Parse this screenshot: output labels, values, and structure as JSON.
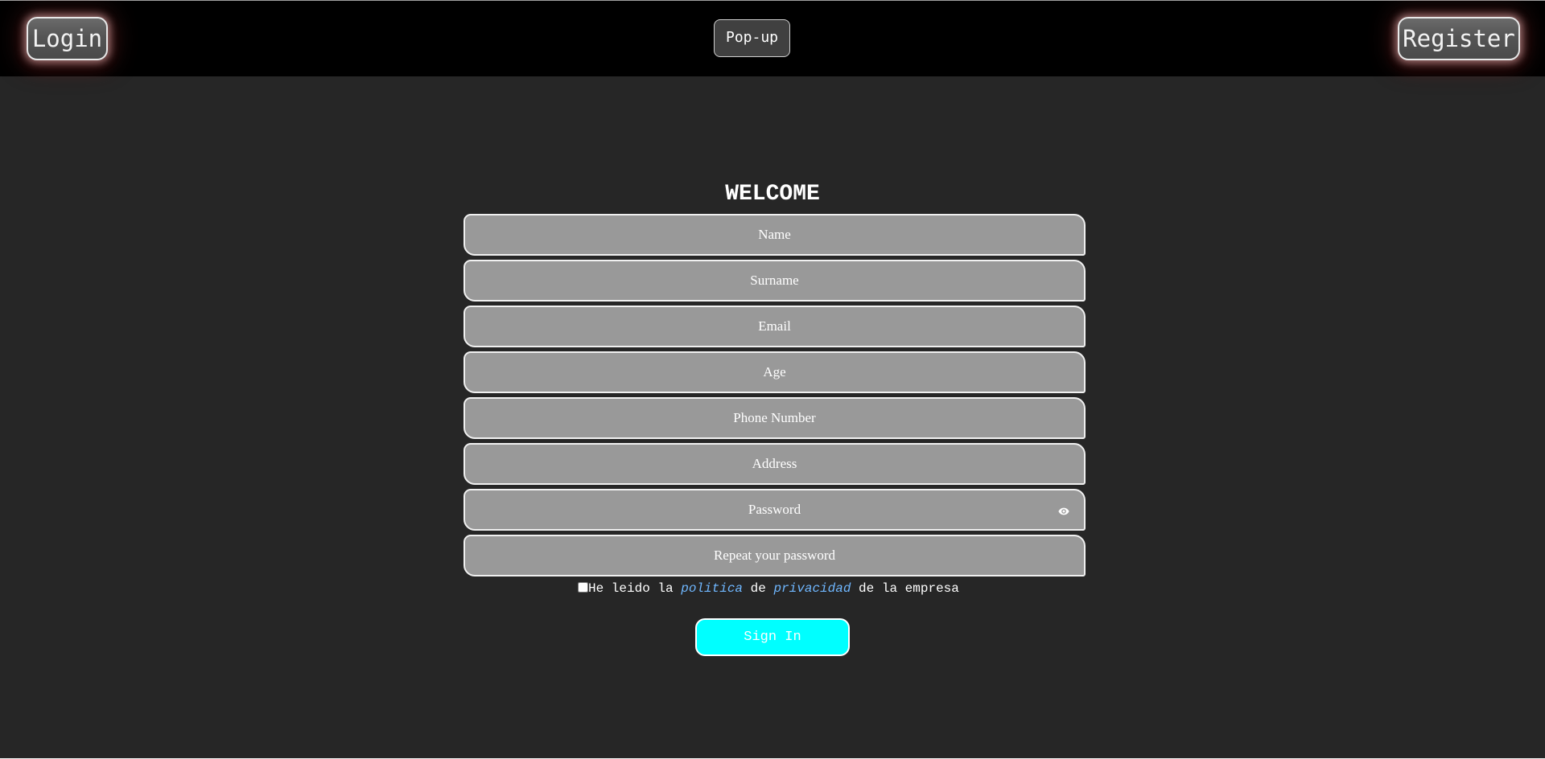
{
  "header": {
    "login_label": "Login",
    "popup_label": "Pop-up",
    "register_label": "Register"
  },
  "form": {
    "title": "WELCOME",
    "fields": {
      "name": "Name",
      "surname": "Surname",
      "email": "Email",
      "age": "Age",
      "phone": "Phone Number",
      "address": "Address",
      "password": "Password",
      "repeat_password": "Repeat your password"
    },
    "password_toggle_icon": "eye-icon",
    "privacy": {
      "text_1": "He leido la ",
      "link_1": "politica",
      "text_2": " de ",
      "link_2": "privacidad",
      "text_3": " de la empresa",
      "checked": false
    },
    "submit_label": "Sign In"
  },
  "colors": {
    "background": "#262626",
    "header": "#000000",
    "field": "#999999",
    "submit": "#00ffff",
    "link": "#6fb7ff"
  }
}
